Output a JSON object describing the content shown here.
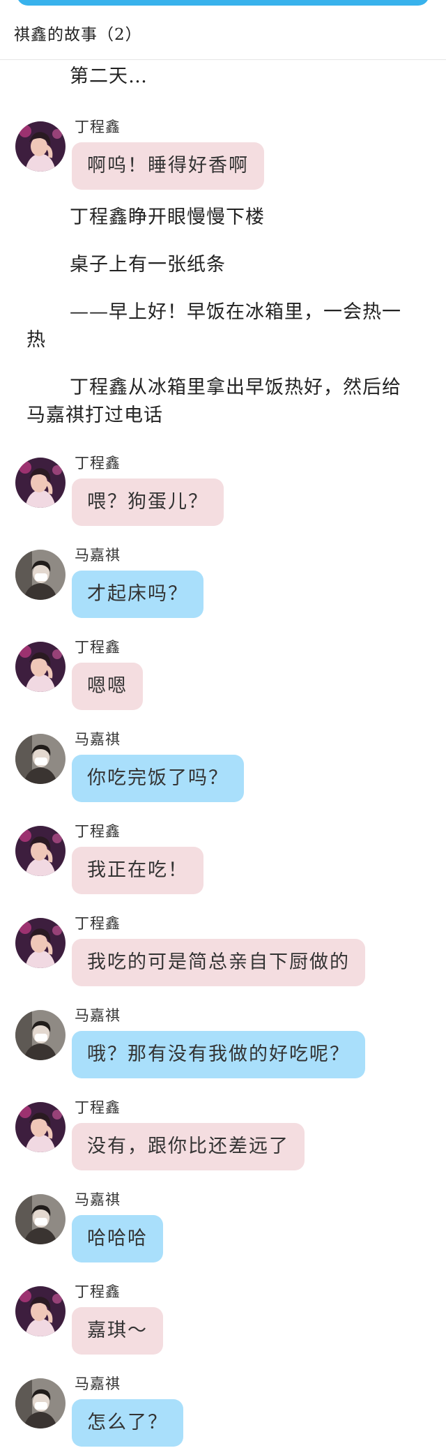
{
  "header": {
    "title": "祺鑫的故事（2）"
  },
  "colors": {
    "accent_bar": "#38b2ec",
    "ding_bubble": "#f4dde0",
    "ma_bubble": "#a9dffb"
  },
  "story": [
    {
      "type": "narration",
      "text": "第二天…"
    },
    {
      "type": "message",
      "sender": "丁程鑫",
      "text": "啊呜！睡得好香啊"
    },
    {
      "type": "narration",
      "text": "丁程鑫睁开眼慢慢下楼"
    },
    {
      "type": "narration",
      "text": "桌子上有一张纸条"
    },
    {
      "type": "narration",
      "text": "——早上好！早饭在冰箱里，一会热一热"
    },
    {
      "type": "narration",
      "text": "丁程鑫从冰箱里拿出早饭热好，然后给马嘉祺打过电话"
    },
    {
      "type": "message",
      "sender": "丁程鑫",
      "text": "喂？狗蛋儿？"
    },
    {
      "type": "message",
      "sender": "马嘉祺",
      "text": "才起床吗？"
    },
    {
      "type": "message",
      "sender": "丁程鑫",
      "text": "嗯嗯"
    },
    {
      "type": "message",
      "sender": "马嘉祺",
      "text": "你吃完饭了吗？"
    },
    {
      "type": "message",
      "sender": "丁程鑫",
      "text": "我正在吃！"
    },
    {
      "type": "message",
      "sender": "丁程鑫",
      "text": "我吃的可是简总亲自下厨做的"
    },
    {
      "type": "message",
      "sender": "马嘉祺",
      "text": "哦？那有没有我做的好吃呢？"
    },
    {
      "type": "message",
      "sender": "丁程鑫",
      "text": "没有，跟你比还差远了"
    },
    {
      "type": "message",
      "sender": "马嘉祺",
      "text": "哈哈哈"
    },
    {
      "type": "message",
      "sender": "丁程鑫",
      "text": "嘉琪～"
    },
    {
      "type": "message",
      "sender": "马嘉祺",
      "text": "怎么了？"
    }
  ]
}
